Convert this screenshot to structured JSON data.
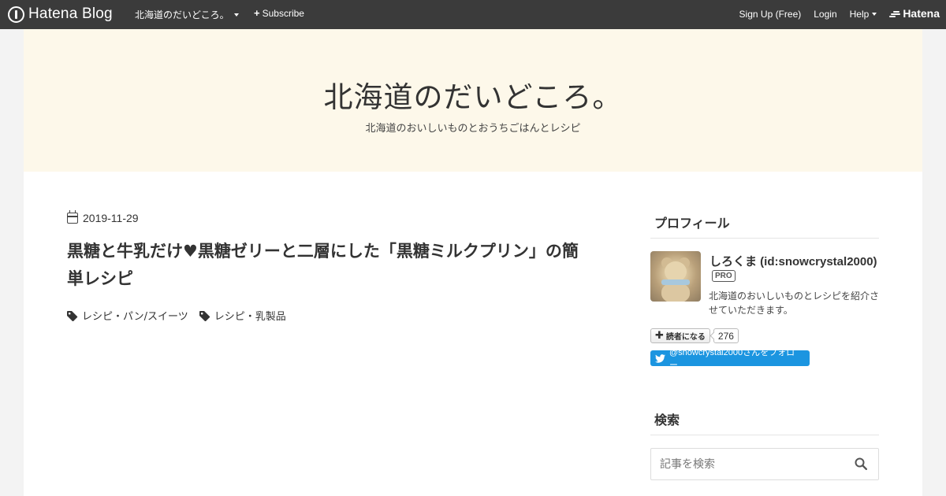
{
  "globalbar": {
    "logo_text": "Hatena Blog",
    "blog_menu": "北海道のだいどころ。",
    "subscribe": "Subscribe",
    "signup": "Sign Up (Free)",
    "login": "Login",
    "help": "Help",
    "hatena": "Hatena"
  },
  "header": {
    "title": "北海道のだいどころ。",
    "description": "北海道のおいしいものとおうちごはんとレシピ"
  },
  "entry": {
    "date": "2019-11-29",
    "title": "黒糖と牛乳だけ♥黒糖ゼリーと二層にした「黒糖ミルクプリン」の簡単レシピ",
    "categories": [
      "レシピ・パン/スイーツ",
      "レシピ・乳製品"
    ]
  },
  "sidebar": {
    "profile": {
      "heading": "プロフィール",
      "name": "しろくま (id:snowcrystal2000)",
      "badge": "PRO",
      "description": "北海道のおいしいものとレシピを紹介させていただきます。",
      "subscribe_label": "読者になる",
      "subscriber_count": "276",
      "twitter_follow": "@snowcrystal2000さんをフォロー"
    },
    "search": {
      "heading": "検索",
      "placeholder": "記事を検索"
    }
  },
  "colors": {
    "globalbar_bg": "#3b3b3b",
    "header_bg": "#fdf8ea",
    "twitter_blue": "#1b95e0"
  }
}
